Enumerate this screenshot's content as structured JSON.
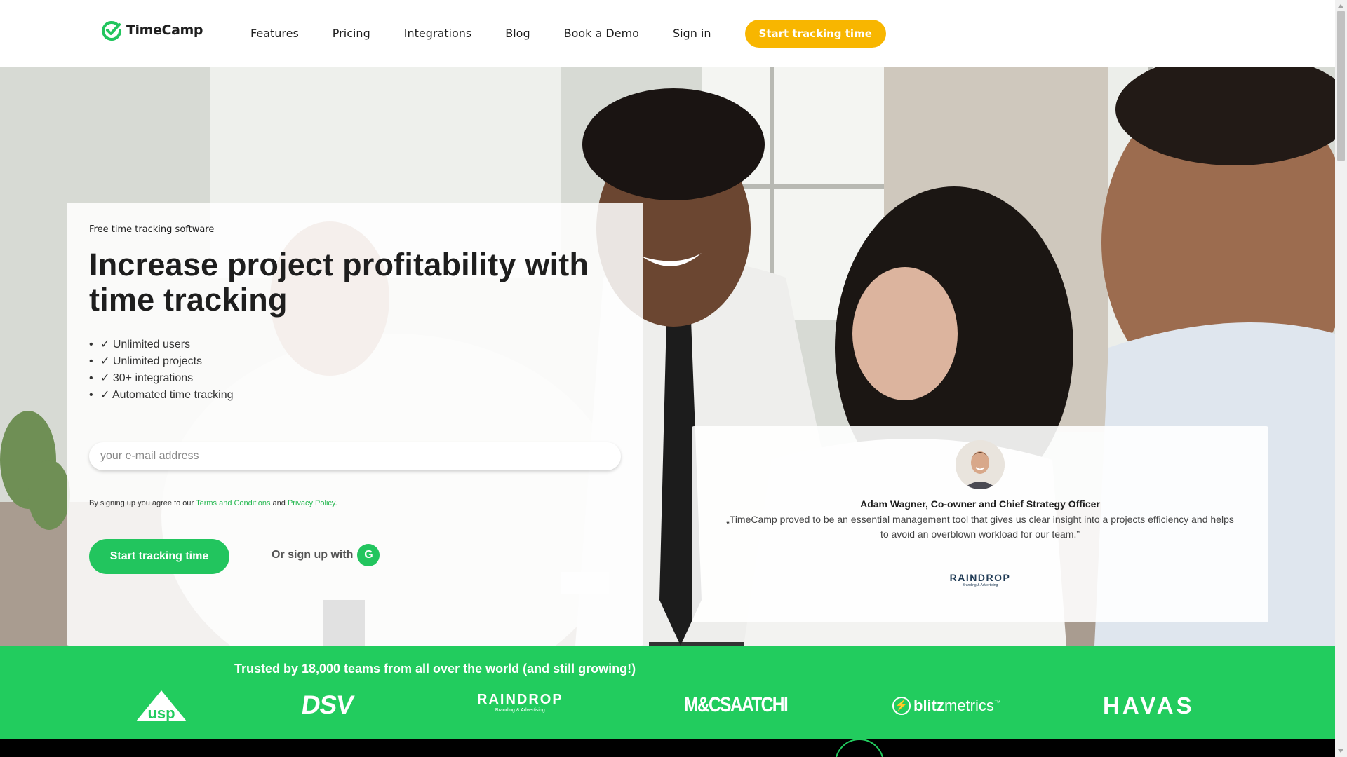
{
  "header": {
    "logo_text": "TimeCamp",
    "nav": [
      "Features",
      "Pricing",
      "Integrations",
      "Blog",
      "Book a Demo",
      "Sign in"
    ],
    "cta": "Start tracking time"
  },
  "hero": {
    "eyebrow": "Free time tracking software",
    "headline": "Increase project profitability with time tracking",
    "features": [
      "✓ Unlimited users",
      "✓ Unlimited projects",
      "✓ 30+ integrations",
      "✓ Automated time tracking"
    ],
    "email_placeholder": "your e-mail address",
    "legal_prefix": "By signing up you agree to our ",
    "legal_terms": "Terms and Conditions",
    "legal_and": " and ",
    "legal_privacy": "Privacy Policy",
    "legal_suffix": ".",
    "start_button": "Start tracking time",
    "or_signup": "Or sign up with",
    "google_letter": "G"
  },
  "testimonial": {
    "name": "Adam Wagner, Co-owner and Chief Strategy Officer",
    "quote": "„TimeCamp proved to be an essential management tool that gives us clear insight into a projects efficiency and helps to avoid an overblown workload for our team.”",
    "company_logo": "RAINDROP",
    "company_tagline": "Branding & Advertising"
  },
  "trusted": {
    "title": "Trusted by 18,000 teams from all over the world (and still growing!)",
    "brands": {
      "usp": "usp",
      "dsv": "DSV",
      "raindrop": "RAINDROP",
      "raindrop_tagline": "Branding & Advertising",
      "mcsaatchi": "M&CSAATCHI",
      "blitz_bold": "blitz",
      "blitz_rest": "metrics",
      "blitz_tm": "™",
      "havas": "HAVAS"
    }
  },
  "colors": {
    "brand_green": "#22cc5e",
    "cta_yellow": "#f8b600",
    "text_dark": "#1e1e1e"
  }
}
